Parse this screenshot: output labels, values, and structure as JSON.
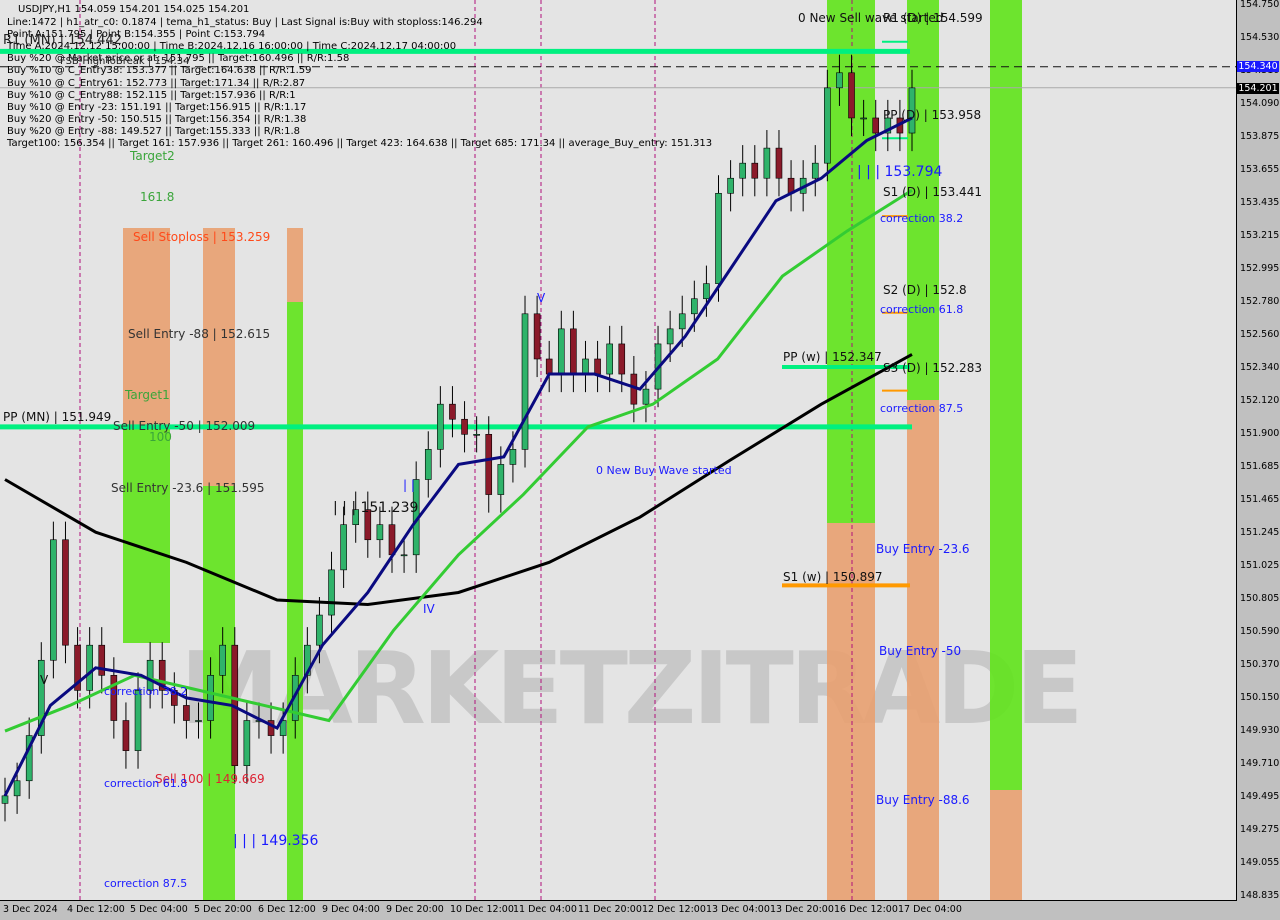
{
  "header": {
    "symbol_line": "USDJPY,H1  154.059 154.201 154.025 154.201",
    "info_lines": [
      "Line:1472 | h1_atr_c0: 0.1874 | tema_h1_status: Buy | Last Signal is:Buy with stoploss:146.294",
      "Point A:151.795 | Point B:154.355 | Point C:153.794",
      "Time A:2024.12.12 15:00:00 | Time B:2024.12.16 16:00:00 | Time C:2024.12.17 04:00:00",
      "Buy %20 @ Market price or at: 151.795 || Target:160.496 || R/R:1.58",
      "Buy %10 @ C_Entry38: 153.377 || Target:164.638 || R/R:1.59",
      "Buy %10 @ C_Entry61: 152.773 || Target:171.34 || R/R:2.87",
      "Buy %10 @ C_Entry88: 152.115 || Target:157.936 || R/R:1",
      "Buy %10 @ Entry -23: 151.191 || Target:156.915 || R/R:1.17",
      "Buy %20 @ Entry -50: 150.515 || Target:156.354 || R/R:1.38",
      "Buy %20 @ Entry -88: 149.527 || Target:155.333 || R/R:1.8",
      "Target100: 156.354 || Target 161: 157.936 || Target 261: 160.496 || Target 423: 164.638 || Target 685: 171.34 || average_Buy_entry: 151.313"
    ]
  },
  "labels": {
    "r1_mn": "R1 (MN) | 154.442",
    "high_week": "FSB-HighToBreak | 154.34",
    "target2": "Target2",
    "fib_1618": "161.8",
    "sell_stoploss": "Sell Stoploss | 153.259",
    "sell_entry_88": "Sell Entry -88 | 152.615",
    "target1": "Target1",
    "pp_mn": "PP (MN) | 151.949",
    "sell_entry_50": "Sell Entry -50 | 152.009",
    "fib_100": "100",
    "sell_entry_236": "Sell Entry -23.6 | 151.595",
    "wave_151": "| | | 151.239",
    "sell_100": "Sell 100 | 149.669",
    "wave_149": "| | | 149.356",
    "corr_382_left": "correction 38.2",
    "corr_618_left": "correction 61.8",
    "corr_875_left": "correction 87.5",
    "new_buy_wave": "0 New Buy Wave started",
    "new_sell_wave": "0 New Sell wave started",
    "r1_d": "R1 (D) | 154.599",
    "pp_d": "PP (D) | 153.958",
    "wave_153": "| | | 153.794",
    "s1_d": "S1 (D) | 153.441",
    "corr_382": "correction 38.2",
    "s2_d": "S2 (D) | 152.8",
    "corr_618": "correction 61.8",
    "pp_w": "PP (w) | 152.347",
    "s3_d": "S3 (D) | 152.283",
    "corr_875": "correction 87.5",
    "buy_entry_236": "Buy Entry -23.6",
    "s1_w": "S1 (w) | 150.897",
    "buy_entry_50": "Buy Entry -50",
    "buy_entry_886": "Buy Entry -88.6",
    "wave_v1": "V",
    "wave_v2": "V",
    "wave_iv": "IV",
    "wave_i": "| |"
  },
  "watermark": "MARKETZITRADE",
  "price_tags": {
    "ask": "154.340",
    "bid": "154.201"
  },
  "colors": {
    "bull": "#2fb36a",
    "bear": "#8b1a2a",
    "green_zone": "#5fe31a",
    "orange_zone": "#e8a070",
    "pivot": "#00f080",
    "fast_ma": "#0a0a80",
    "mid_ma": "#33cc33",
    "slow_ma": "#000000"
  },
  "chart_data": {
    "type": "candlestick",
    "symbol": "USDJPY",
    "timeframe": "H1",
    "ylim": [
      148.835,
      154.75
    ],
    "y_ticks": [
      "154.750",
      "154.530",
      "154.310",
      "154.090",
      "153.875",
      "153.655",
      "153.435",
      "153.215",
      "152.995",
      "152.780",
      "152.560",
      "152.340",
      "152.120",
      "151.900",
      "151.685",
      "151.465",
      "151.245",
      "151.025",
      "150.805",
      "150.590",
      "150.370",
      "150.150",
      "149.930",
      "149.710",
      "149.495",
      "149.275",
      "149.055",
      "148.835"
    ],
    "x_ticks": [
      "3 Dec 2024",
      "4 Dec 12:00",
      "5 Dec 04:00",
      "5 Dec 20:00",
      "6 Dec 12:00",
      "9 Dec 04:00",
      "9 Dec 20:00",
      "10 Dec 12:00",
      "11 Dec 04:00",
      "11 Dec 20:00",
      "12 Dec 12:00",
      "13 Dec 04:00",
      "13 Dec 20:00",
      "16 Dec 12:00",
      "17 Dec 04:00"
    ],
    "close": [
      149.5,
      149.6,
      149.9,
      150.4,
      151.2,
      150.5,
      150.2,
      150.5,
      150.3,
      150.0,
      149.8,
      150.2,
      150.4,
      150.2,
      150.1,
      150.0,
      150.0,
      150.3,
      150.5,
      149.7,
      150.0,
      150.0,
      149.9,
      150.0,
      150.3,
      150.5,
      150.7,
      151.0,
      151.3,
      151.4,
      151.2,
      151.3,
      151.1,
      151.1,
      151.6,
      151.8,
      152.1,
      152.0,
      151.9,
      151.9,
      151.5,
      151.7,
      151.8,
      152.7,
      152.4,
      152.3,
      152.6,
      152.3,
      152.4,
      152.3,
      152.5,
      152.3,
      152.1,
      152.2,
      152.5,
      152.6,
      152.7,
      152.8,
      152.9,
      153.5,
      153.6,
      153.7,
      153.6,
      153.8,
      153.6,
      153.5,
      153.6,
      153.7,
      154.2,
      154.3,
      154.0,
      154.0,
      153.9,
      154.0,
      153.9,
      154.2
    ],
    "series": [
      {
        "values": [
          149.5,
          150.1,
          150.35,
          150.3,
          150.15,
          150.1,
          149.95,
          150.5,
          150.85,
          151.3,
          151.7,
          151.75,
          152.3,
          152.3,
          152.2,
          152.55,
          153.0,
          153.45,
          153.6,
          153.85,
          154.0
        ]
      },
      {
        "values": [
          149.93,
          150.1,
          150.3,
          150.2,
          150.1,
          150.0,
          150.6,
          151.1,
          151.5,
          151.95,
          152.1,
          152.4,
          152.95,
          153.25,
          153.52
        ]
      },
      {
        "values": [
          151.6,
          151.25,
          151.05,
          150.8,
          150.77,
          150.85,
          151.05,
          151.35,
          151.73,
          152.1,
          152.43
        ]
      }
    ],
    "levels": {
      "r1_mn": 154.442,
      "fsb_high": 154.34,
      "bid": 154.201,
      "pp_mn": 151.949,
      "pp_w": 152.347,
      "s1_w": 150.897,
      "r1_d": 154.599,
      "pp_d": 153.958,
      "s1_d": 153.441,
      "s2_d": 152.8,
      "s3_d": 152.283
    }
  }
}
